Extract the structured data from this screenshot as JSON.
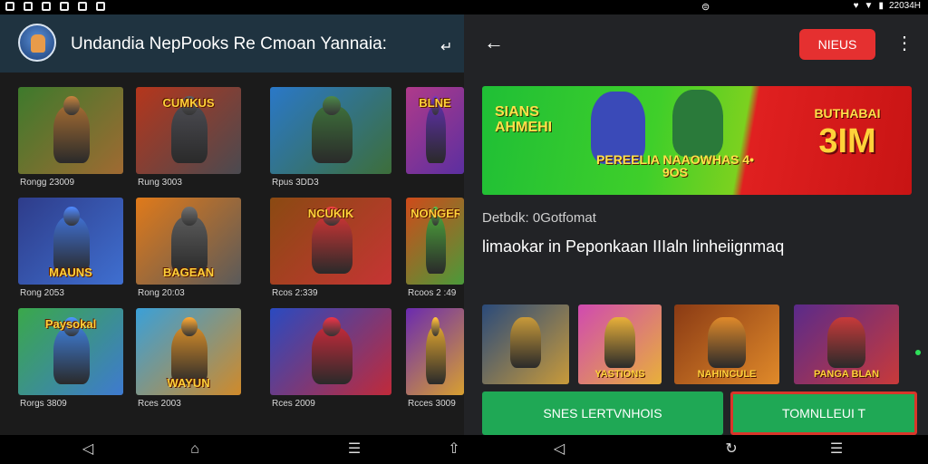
{
  "colors": {
    "accent_red": "#e53030",
    "accent_green": "#1fa855",
    "left_appbar": "#1f3340"
  },
  "left_screen": {
    "status_icons": [
      "notification-icon",
      "gallery-icon",
      "download-icon",
      "location-icon",
      "cast-icon",
      "add-icon"
    ],
    "app_title": "Undandia NepPooks Re Cmoan Yannaia:",
    "title_arrow": "↵",
    "tiles": [
      {
        "banner": "",
        "caption": "Rongg 23009",
        "colors": [
          "#3d7a2c",
          "#a06a32"
        ]
      },
      {
        "banner": "CUMKUS",
        "caption": "Rung 3003",
        "colors": [
          "#b5361c",
          "#4a4a50"
        ]
      },
      {
        "banner": "",
        "caption": "Rpus 3DD3",
        "colors": [
          "#2a78c8",
          "#3d6e3a"
        ]
      },
      {
        "banner": "BLNE",
        "caption": "",
        "colors": [
          "#b03a8a",
          "#5b2fa0"
        ]
      },
      {
        "banner": "MAUNS",
        "caption": "Rong 2053",
        "colors": [
          "#2e3c8a",
          "#3f6fd0"
        ]
      },
      {
        "banner": "BAGEAN",
        "caption": "Rong 20:03",
        "colors": [
          "#e07a1a",
          "#5a5a5a"
        ]
      },
      {
        "banner": "NCUKIK",
        "caption": "Rcos 2:339",
        "colors": [
          "#8a4a12",
          "#c63434"
        ]
      },
      {
        "banner": "NONGER",
        "caption": "Rcoos 2 :49",
        "colors": [
          "#d04a1a",
          "#4a9a3a"
        ]
      },
      {
        "banner": "Paysokal",
        "caption": "Rorgs 3809",
        "colors": [
          "#3aa84a",
          "#3e7ad0"
        ]
      },
      {
        "banner": "WAYUN",
        "caption": "Rces 2003",
        "colors": [
          "#3aa0d8",
          "#d08a2a"
        ]
      },
      {
        "banner": "",
        "caption": "Rces 2009",
        "colors": [
          "#2a4ac0",
          "#c02a3a"
        ]
      },
      {
        "banner": "",
        "caption": "Rcces 3009",
        "colors": [
          "#6a2ab0",
          "#d8a030"
        ]
      }
    ]
  },
  "right_screen": {
    "status_time": "22034H",
    "menu_label": "NIEUS",
    "banner": {
      "left_text": "SIANS AHMEHI",
      "center_text": "PEREELIA NAAOWHAS 4• 9OS",
      "right_title": "BUTHABAI",
      "right_big": "3IM"
    },
    "subtitle": "Detbdk: 0Gotfomat",
    "headline": "limaokar in Peponkaan IIIaln linheiignmaq",
    "thumbs": [
      {
        "label": "",
        "colors": [
          "#2a4a7a",
          "#c89a3a"
        ]
      },
      {
        "label": "YASTIONS",
        "colors": [
          "#d04ab0",
          "#e8b03a"
        ]
      },
      {
        "label": "NAHINCULE",
        "colors": [
          "#8a3a14",
          "#e08a2a"
        ]
      },
      {
        "label": "PANGA BLAN",
        "colors": [
          "#5a2a8a",
          "#c83a3a"
        ]
      }
    ],
    "button_secondary": "SNES LERTVNHOIS",
    "button_primary": "TOMNLLEUI T"
  }
}
